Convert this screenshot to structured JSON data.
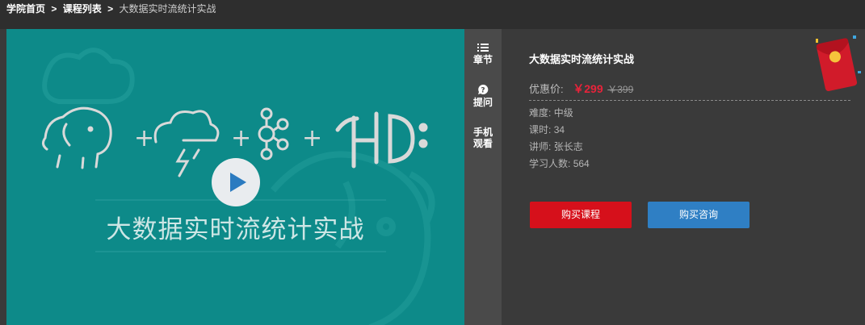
{
  "breadcrumb": {
    "home": "学院首页",
    "list": "课程列表",
    "current": "大数据实时流统计实战",
    "sep": ">"
  },
  "player": {
    "poster_title": "大数据实时流统计实战",
    "plus": "+"
  },
  "tools": {
    "chapters": "章节",
    "question": "提问",
    "mobile_line1": "手机",
    "mobile_line2": "观看"
  },
  "course": {
    "name": "大数据实时流统计实战",
    "price_label": "优惠价:",
    "price_now": "￥299",
    "price_old": "￥399",
    "difficulty_label": "难度:",
    "difficulty_value": "中级",
    "lessons_label": "课时:",
    "lessons_value": "34",
    "teacher_label": "讲师:",
    "teacher_value": "张长志",
    "students_label": "学习人数:",
    "students_value": "564"
  },
  "actions": {
    "buy": "购买课程",
    "consult": "购买咨询"
  },
  "colors": {
    "poster_bg": "#0d8a89",
    "price_red": "#e8233a",
    "buy_bg": "#d6101b",
    "consult_bg": "#2f7fc4"
  }
}
